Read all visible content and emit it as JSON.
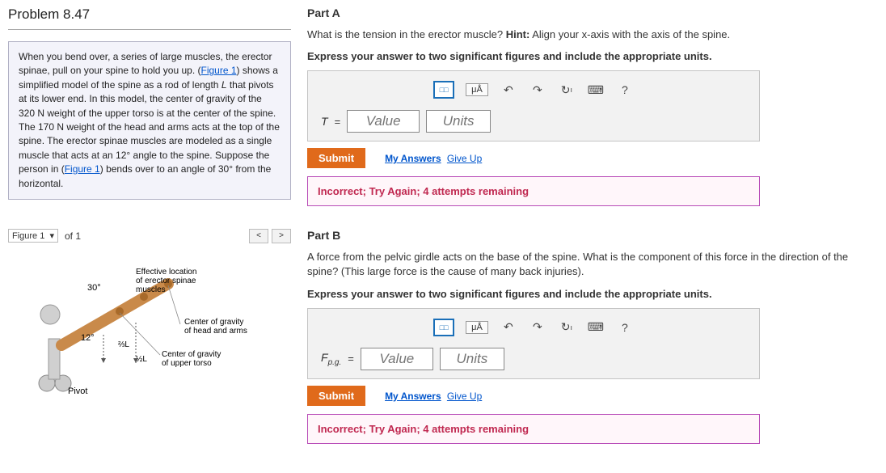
{
  "problem": {
    "title": "Problem 8.47",
    "description_pre": "When you bend over, a series of large muscles, the erector spinae, pull on your spine to hold you up. (",
    "fig1_link": "Figure 1",
    "description_mid1": ") shows a simplified model of the spine as a rod of length ",
    "L": "L",
    "description_mid2": " that pivots at its lower end. In this model, the center of gravity of the 320 ",
    "N1": "N",
    "description_mid3": " weight of the upper torso is at the center of the spine. The 170 ",
    "N2": "N",
    "description_mid4": " weight of the head and arms acts at the top of the spine. The erector spinae muscles are modeled as a single muscle that acts at an 12",
    "deg1": "°",
    "description_mid5": " angle to the spine. Suppose the person in (",
    "fig1_link2": "Figure 1",
    "description_mid6": ") bends over to an angle of 30",
    "deg2": "°",
    "description_end": " from the horizontal."
  },
  "figure": {
    "select_label": "Figure 1",
    "of_text": "of 1",
    "prev": "<",
    "next": ">",
    "angle30": "30°",
    "angle12": "12°",
    "label_erector": "Effective location of erector spinae muscles",
    "label_head": "Center of gravity of head and arms",
    "label_torso": "Center of gravity of upper torso",
    "pivot": "Pivot",
    "frac23": "⅔L",
    "frac12": "½L"
  },
  "toolbar": {
    "symbols": "□□",
    "ua": "μÅ",
    "undo": "↶",
    "redo": "↷",
    "reset": "↻",
    "keyboard": "⌨",
    "help": "?"
  },
  "inputs": {
    "value_ph": "Value",
    "units_ph": "Units"
  },
  "actions": {
    "submit": "Submit",
    "my_answers": "My Answers",
    "give_up": "Give Up"
  },
  "partA": {
    "header": "Part A",
    "question_pre": "What is the tension in the erector muscle? ",
    "hint_label": "Hint:",
    "hint_text": " Align your x-axis with the axis of the spine.",
    "instruction": "Express your answer to two significant figures and include the appropriate units.",
    "var": "T",
    "eq": "=",
    "feedback": "Incorrect; Try Again; 4 attempts remaining"
  },
  "partB": {
    "header": "Part B",
    "question": "A force from the pelvic girdle acts on the base of the spine. What is the component of this force in the direction of the spine? (This large force is the cause of many back injuries).",
    "instruction": "Express your answer to two significant figures and include the appropriate units.",
    "var": "F",
    "var_sub": "p.g.",
    "eq": "=",
    "feedback": "Incorrect; Try Again; 4 attempts remaining"
  }
}
